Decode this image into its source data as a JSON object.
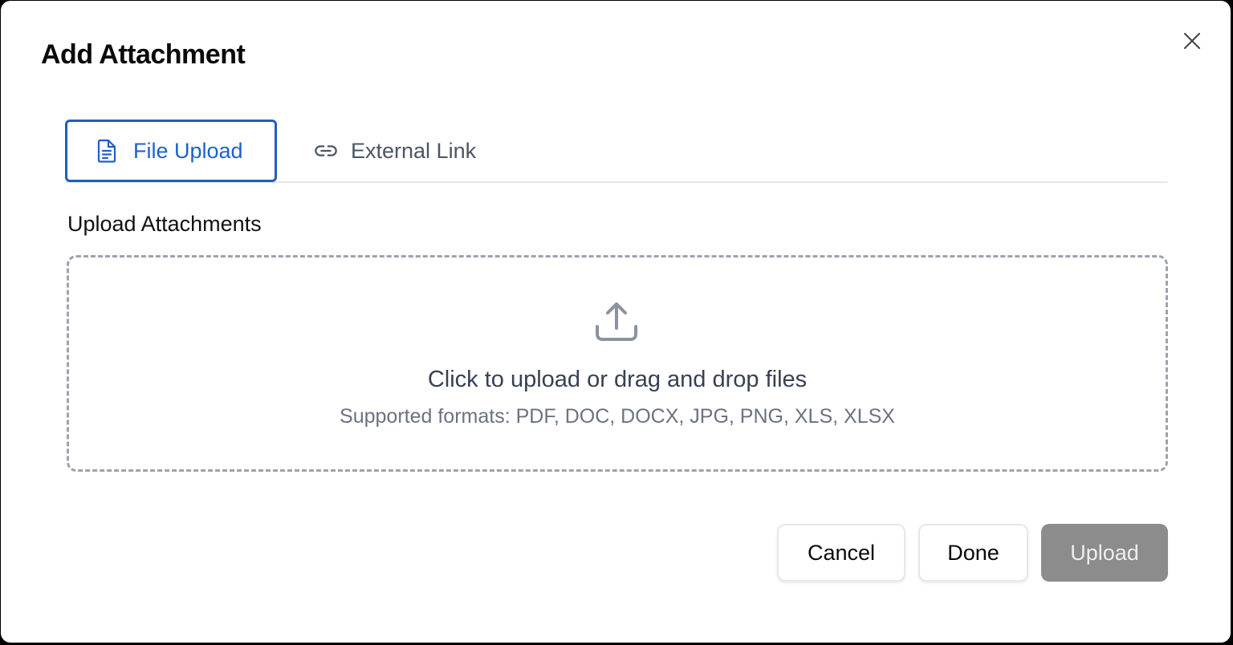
{
  "dialog": {
    "title": "Add Attachment",
    "close_icon": "close-icon"
  },
  "tabs": [
    {
      "label": "File Upload",
      "icon": "document-icon",
      "active": true
    },
    {
      "label": "External Link",
      "icon": "link-icon",
      "active": false
    }
  ],
  "upload": {
    "section_label": "Upload Attachments",
    "icon": "upload-icon",
    "main_text": "Click to upload or drag and drop files",
    "sub_text": "Supported formats: PDF, DOC, DOCX, JPG, PNG, XLS, XLSX"
  },
  "footer": {
    "cancel_label": "Cancel",
    "done_label": "Done",
    "upload_label": "Upload"
  },
  "colors": {
    "accent": "#1f5fbf",
    "disabled_button": "#8c8c8c",
    "dropzone_border": "#9ca3af"
  }
}
